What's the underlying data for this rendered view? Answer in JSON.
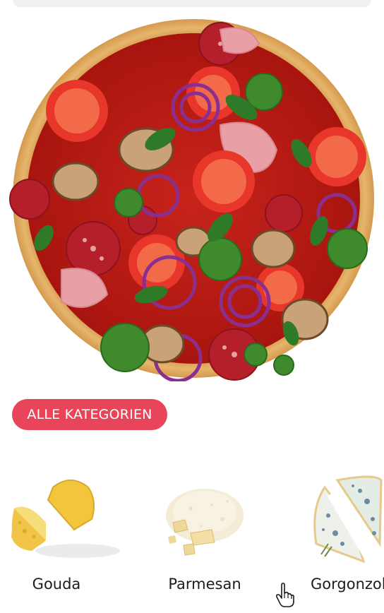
{
  "pizza": {
    "icon": "pizza-image"
  },
  "category_button": {
    "label": "ALLE KATEGORIEN",
    "color": "#e8455a"
  },
  "carousel": {
    "items": [
      {
        "label": "Gouda",
        "icon": "gouda-cheese-image"
      },
      {
        "label": "Parmesan",
        "icon": "parmesan-cheese-image"
      },
      {
        "label": "Gorgonzola",
        "icon": "gorgonzola-cheese-image"
      }
    ]
  },
  "cursor": {
    "icon": "hand-pointer-icon"
  }
}
